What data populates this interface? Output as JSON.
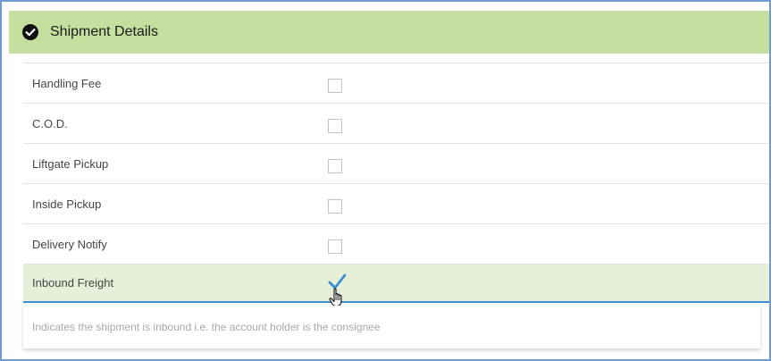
{
  "panel": {
    "title": "Shipment Details",
    "header_color": "#c5df9f",
    "icon": "check-circle-icon"
  },
  "options": [
    {
      "label": "Handling Fee",
      "checked": false
    },
    {
      "label": "C.O.D.",
      "checked": false
    },
    {
      "label": "Liftgate Pickup",
      "checked": false
    },
    {
      "label": "Inside Pickup",
      "checked": false
    },
    {
      "label": "Delivery Notify",
      "checked": false
    },
    {
      "label": "Inbound Freight",
      "checked": true
    }
  ],
  "tooltip": {
    "text": "Indicates the shipment is inbound i.e. the account holder is the consignee"
  },
  "colors": {
    "accent": "#3b8ed3",
    "selected_row": "#e6efd8",
    "frame_border": "#6f9ad3"
  }
}
